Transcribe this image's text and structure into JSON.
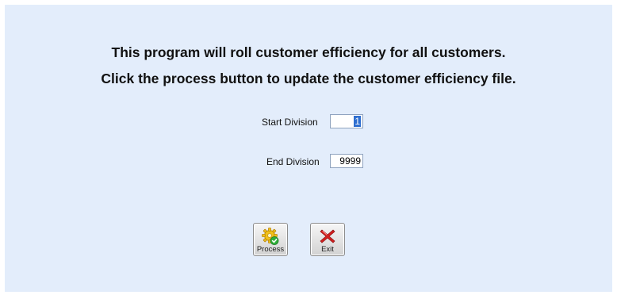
{
  "instructions": {
    "line1": "This program will roll customer efficiency for all customers.",
    "line2": "Click the process button to update the customer efficiency file."
  },
  "fields": {
    "start_division": {
      "label": "Start Division",
      "value": "1"
    },
    "end_division": {
      "label": "End Division",
      "value": "9999"
    }
  },
  "buttons": {
    "process": {
      "label": "Process",
      "icon": "gear-check-icon"
    },
    "exit": {
      "label": "Exit",
      "icon": "red-x-icon"
    }
  },
  "colors": {
    "panel_background": "#e3edfb",
    "selection": "#2f6fd0",
    "exit_icon": "#d42020",
    "process_icon": "#f2c118"
  }
}
